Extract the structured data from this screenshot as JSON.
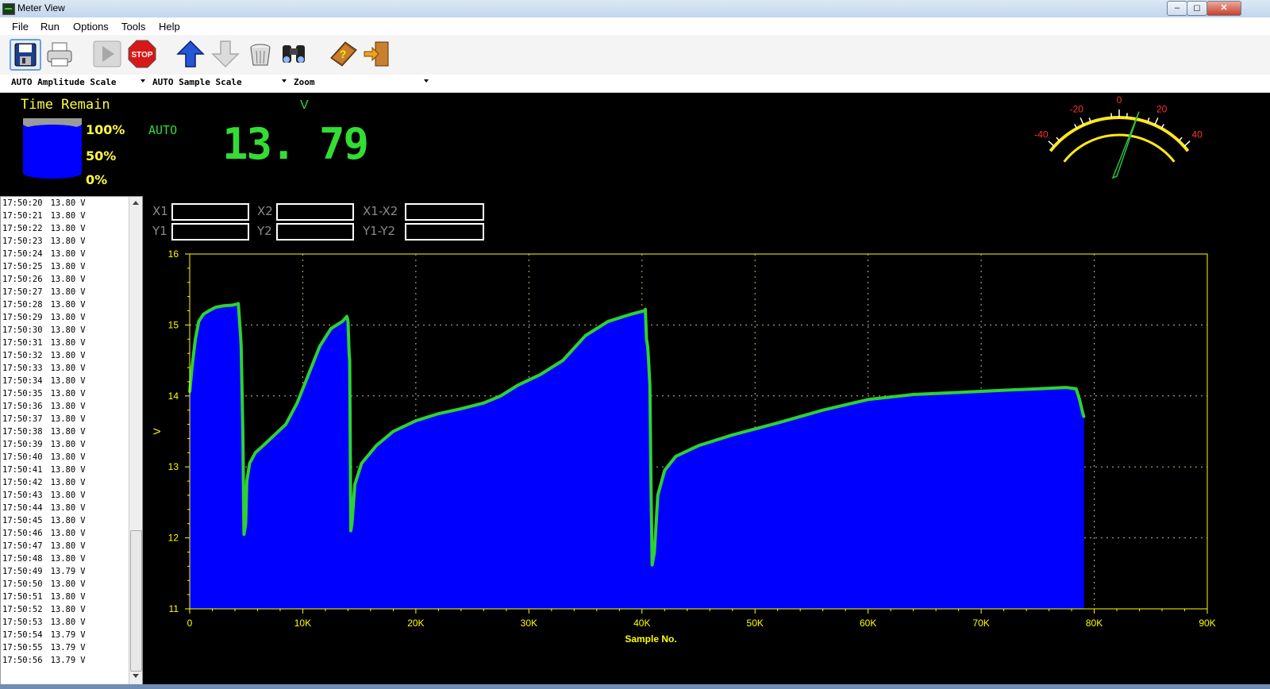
{
  "window": {
    "title": "Meter View",
    "controls": {
      "minimize": "–",
      "restore": "◻",
      "close": "✕"
    }
  },
  "menu": [
    "File",
    "Run",
    "Options",
    "Tools",
    "Help"
  ],
  "toolbar": [
    {
      "name": "save-button",
      "icon": "floppy-disk-icon"
    },
    {
      "name": "print-button",
      "icon": "printer-icon"
    },
    {
      "name": "play-button",
      "icon": "play-icon"
    },
    {
      "name": "stop-button",
      "icon": "stop-sign-icon",
      "text": "STOP"
    },
    {
      "name": "upload-button",
      "icon": "arrow-up-icon"
    },
    {
      "name": "download-button",
      "icon": "arrow-down-icon"
    },
    {
      "name": "clear-button",
      "icon": "trash-can-icon"
    },
    {
      "name": "find-button",
      "icon": "binoculars-icon"
    },
    {
      "name": "help-button",
      "icon": "help-book-icon"
    },
    {
      "name": "exit-button",
      "icon": "exit-door-icon"
    }
  ],
  "selectors": {
    "amplitude": "AUTO Amplitude Scale",
    "sample": "AUTO Sample Scale",
    "zoom": "Zoom"
  },
  "battery": {
    "title": "Time Remain",
    "levels": [
      "100%",
      "50%",
      "0%"
    ]
  },
  "display": {
    "unit": "V",
    "mode": "AUTO",
    "value": "13. 79"
  },
  "gauge": {
    "ticks": [
      "-40",
      "-20",
      "0",
      "20",
      "40"
    ],
    "colors": {
      "arc": "#ffe81a",
      "labels": "#ff3333",
      "needle": "#2fbf3f"
    }
  },
  "log": [
    [
      "17:50:20",
      "13.80",
      "V"
    ],
    [
      "17:50:21",
      "13.80",
      "V"
    ],
    [
      "17:50:22",
      "13.80",
      "V"
    ],
    [
      "17:50:23",
      "13.80",
      "V"
    ],
    [
      "17:50:24",
      "13.80",
      "V"
    ],
    [
      "17:50:25",
      "13.80",
      "V"
    ],
    [
      "17:50:26",
      "13.80",
      "V"
    ],
    [
      "17:50:27",
      "13.80",
      "V"
    ],
    [
      "17:50:28",
      "13.80",
      "V"
    ],
    [
      "17:50:29",
      "13.80",
      "V"
    ],
    [
      "17:50:30",
      "13.80",
      "V"
    ],
    [
      "17:50:31",
      "13.80",
      "V"
    ],
    [
      "17:50:32",
      "13.80",
      "V"
    ],
    [
      "17:50:33",
      "13.80",
      "V"
    ],
    [
      "17:50:34",
      "13.80",
      "V"
    ],
    [
      "17:50:35",
      "13.80",
      "V"
    ],
    [
      "17:50:36",
      "13.80",
      "V"
    ],
    [
      "17:50:37",
      "13.80",
      "V"
    ],
    [
      "17:50:38",
      "13.80",
      "V"
    ],
    [
      "17:50:39",
      "13.80",
      "V"
    ],
    [
      "17:50:40",
      "13.80",
      "V"
    ],
    [
      "17:50:41",
      "13.80",
      "V"
    ],
    [
      "17:50:42",
      "13.80",
      "V"
    ],
    [
      "17:50:43",
      "13.80",
      "V"
    ],
    [
      "17:50:44",
      "13.80",
      "V"
    ],
    [
      "17:50:45",
      "13.80",
      "V"
    ],
    [
      "17:50:46",
      "13.80",
      "V"
    ],
    [
      "17:50:47",
      "13.80",
      "V"
    ],
    [
      "17:50:48",
      "13.80",
      "V"
    ],
    [
      "17:50:49",
      "13.79",
      "V"
    ],
    [
      "17:50:50",
      "13.80",
      "V"
    ],
    [
      "17:50:51",
      "13.80",
      "V"
    ],
    [
      "17:50:52",
      "13.80",
      "V"
    ],
    [
      "17:50:53",
      "13.80",
      "V"
    ],
    [
      "17:50:54",
      "13.79",
      "V"
    ],
    [
      "17:50:55",
      "13.79",
      "V"
    ],
    [
      "17:50:56",
      "13.79",
      "V"
    ]
  ],
  "cursors": {
    "x1": "X1",
    "x2": "X2",
    "dx": "X1-X2",
    "y1": "Y1",
    "y2": "Y2",
    "dy": "Y1-Y2"
  },
  "chart_data": {
    "type": "area",
    "xlabel": "Sample No.",
    "ylabel": "V",
    "xlim": [
      0,
      90000
    ],
    "ylim": [
      11,
      16
    ],
    "xticks": [
      "0",
      "10K",
      "20K",
      "30K",
      "40K",
      "50K",
      "60K",
      "70K",
      "80K",
      "90K"
    ],
    "yticks": [
      "11",
      "12",
      "13",
      "14",
      "15",
      "16"
    ],
    "grid": true,
    "colors": {
      "fill": "#0000ff",
      "line": "#2fd12f",
      "axis": "#ffff00",
      "grid": "#bbbb88"
    },
    "series": [
      {
        "x": [
          0,
          200,
          500,
          800,
          1200,
          1700,
          2300,
          3000,
          3800,
          4300,
          4500,
          4550,
          4700,
          4800,
          4850,
          4950,
          5050,
          5300,
          5800,
          6500,
          7500,
          8500,
          9500,
          10500,
          11500,
          12500,
          13500,
          13900,
          14000,
          14100,
          14150,
          14250,
          14350,
          14600,
          15200,
          16500,
          18000,
          20000,
          22000,
          24000,
          26000,
          27500,
          29000,
          31000,
          33000,
          35000,
          37000,
          39000,
          40200,
          40300,
          40400,
          40500,
          40550,
          40700,
          40800,
          40900,
          41100,
          41400,
          42000,
          43000,
          45000,
          48000,
          52000,
          56000,
          60000,
          64000,
          68000,
          72000,
          75000,
          77500,
          78400,
          78700,
          79000,
          79100
        ],
        "y": [
          14.05,
          14.4,
          14.8,
          15.05,
          15.15,
          15.2,
          15.25,
          15.27,
          15.28,
          15.3,
          14.85,
          14.7,
          13.5,
          12.05,
          12.1,
          12.2,
          12.8,
          13.05,
          13.2,
          13.3,
          13.45,
          13.6,
          13.9,
          14.3,
          14.7,
          14.95,
          15.05,
          15.12,
          15.05,
          14.6,
          14.5,
          12.1,
          12.2,
          12.75,
          13.05,
          13.3,
          13.5,
          13.65,
          13.75,
          13.82,
          13.9,
          14.0,
          14.15,
          14.3,
          14.5,
          14.85,
          15.05,
          15.15,
          15.2,
          15.22,
          14.8,
          14.7,
          14.6,
          14.15,
          12.7,
          11.62,
          11.8,
          12.6,
          12.95,
          13.15,
          13.3,
          13.45,
          13.62,
          13.8,
          13.95,
          14.02,
          14.05,
          14.08,
          14.1,
          14.12,
          14.1,
          13.95,
          13.75,
          13.7
        ]
      }
    ]
  }
}
